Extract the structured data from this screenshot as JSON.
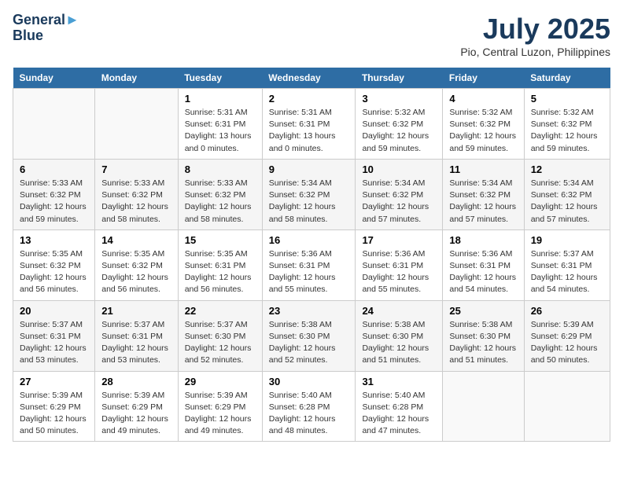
{
  "header": {
    "logo_line1": "General",
    "logo_line2": "Blue",
    "title": "July 2025",
    "subtitle": "Pio, Central Luzon, Philippines"
  },
  "calendar": {
    "days_of_week": [
      "Sunday",
      "Monday",
      "Tuesday",
      "Wednesday",
      "Thursday",
      "Friday",
      "Saturday"
    ],
    "weeks": [
      [
        {
          "day": "",
          "info": ""
        },
        {
          "day": "",
          "info": ""
        },
        {
          "day": "1",
          "sunrise": "5:31 AM",
          "sunset": "6:31 PM",
          "daylight": "13 hours and 0 minutes."
        },
        {
          "day": "2",
          "sunrise": "5:31 AM",
          "sunset": "6:31 PM",
          "daylight": "13 hours and 0 minutes."
        },
        {
          "day": "3",
          "sunrise": "5:32 AM",
          "sunset": "6:32 PM",
          "daylight": "12 hours and 59 minutes."
        },
        {
          "day": "4",
          "sunrise": "5:32 AM",
          "sunset": "6:32 PM",
          "daylight": "12 hours and 59 minutes."
        },
        {
          "day": "5",
          "sunrise": "5:32 AM",
          "sunset": "6:32 PM",
          "daylight": "12 hours and 59 minutes."
        }
      ],
      [
        {
          "day": "6",
          "sunrise": "5:33 AM",
          "sunset": "6:32 PM",
          "daylight": "12 hours and 59 minutes."
        },
        {
          "day": "7",
          "sunrise": "5:33 AM",
          "sunset": "6:32 PM",
          "daylight": "12 hours and 58 minutes."
        },
        {
          "day": "8",
          "sunrise": "5:33 AM",
          "sunset": "6:32 PM",
          "daylight": "12 hours and 58 minutes."
        },
        {
          "day": "9",
          "sunrise": "5:34 AM",
          "sunset": "6:32 PM",
          "daylight": "12 hours and 58 minutes."
        },
        {
          "day": "10",
          "sunrise": "5:34 AM",
          "sunset": "6:32 PM",
          "daylight": "12 hours and 57 minutes."
        },
        {
          "day": "11",
          "sunrise": "5:34 AM",
          "sunset": "6:32 PM",
          "daylight": "12 hours and 57 minutes."
        },
        {
          "day": "12",
          "sunrise": "5:34 AM",
          "sunset": "6:32 PM",
          "daylight": "12 hours and 57 minutes."
        }
      ],
      [
        {
          "day": "13",
          "sunrise": "5:35 AM",
          "sunset": "6:32 PM",
          "daylight": "12 hours and 56 minutes."
        },
        {
          "day": "14",
          "sunrise": "5:35 AM",
          "sunset": "6:32 PM",
          "daylight": "12 hours and 56 minutes."
        },
        {
          "day": "15",
          "sunrise": "5:35 AM",
          "sunset": "6:31 PM",
          "daylight": "12 hours and 56 minutes."
        },
        {
          "day": "16",
          "sunrise": "5:36 AM",
          "sunset": "6:31 PM",
          "daylight": "12 hours and 55 minutes."
        },
        {
          "day": "17",
          "sunrise": "5:36 AM",
          "sunset": "6:31 PM",
          "daylight": "12 hours and 55 minutes."
        },
        {
          "day": "18",
          "sunrise": "5:36 AM",
          "sunset": "6:31 PM",
          "daylight": "12 hours and 54 minutes."
        },
        {
          "day": "19",
          "sunrise": "5:37 AM",
          "sunset": "6:31 PM",
          "daylight": "12 hours and 54 minutes."
        }
      ],
      [
        {
          "day": "20",
          "sunrise": "5:37 AM",
          "sunset": "6:31 PM",
          "daylight": "12 hours and 53 minutes."
        },
        {
          "day": "21",
          "sunrise": "5:37 AM",
          "sunset": "6:31 PM",
          "daylight": "12 hours and 53 minutes."
        },
        {
          "day": "22",
          "sunrise": "5:37 AM",
          "sunset": "6:30 PM",
          "daylight": "12 hours and 52 minutes."
        },
        {
          "day": "23",
          "sunrise": "5:38 AM",
          "sunset": "6:30 PM",
          "daylight": "12 hours and 52 minutes."
        },
        {
          "day": "24",
          "sunrise": "5:38 AM",
          "sunset": "6:30 PM",
          "daylight": "12 hours and 51 minutes."
        },
        {
          "day": "25",
          "sunrise": "5:38 AM",
          "sunset": "6:30 PM",
          "daylight": "12 hours and 51 minutes."
        },
        {
          "day": "26",
          "sunrise": "5:39 AM",
          "sunset": "6:29 PM",
          "daylight": "12 hours and 50 minutes."
        }
      ],
      [
        {
          "day": "27",
          "sunrise": "5:39 AM",
          "sunset": "6:29 PM",
          "daylight": "12 hours and 50 minutes."
        },
        {
          "day": "28",
          "sunrise": "5:39 AM",
          "sunset": "6:29 PM",
          "daylight": "12 hours and 49 minutes."
        },
        {
          "day": "29",
          "sunrise": "5:39 AM",
          "sunset": "6:29 PM",
          "daylight": "12 hours and 49 minutes."
        },
        {
          "day": "30",
          "sunrise": "5:40 AM",
          "sunset": "6:28 PM",
          "daylight": "12 hours and 48 minutes."
        },
        {
          "day": "31",
          "sunrise": "5:40 AM",
          "sunset": "6:28 PM",
          "daylight": "12 hours and 47 minutes."
        },
        {
          "day": "",
          "info": ""
        },
        {
          "day": "",
          "info": ""
        }
      ]
    ]
  }
}
